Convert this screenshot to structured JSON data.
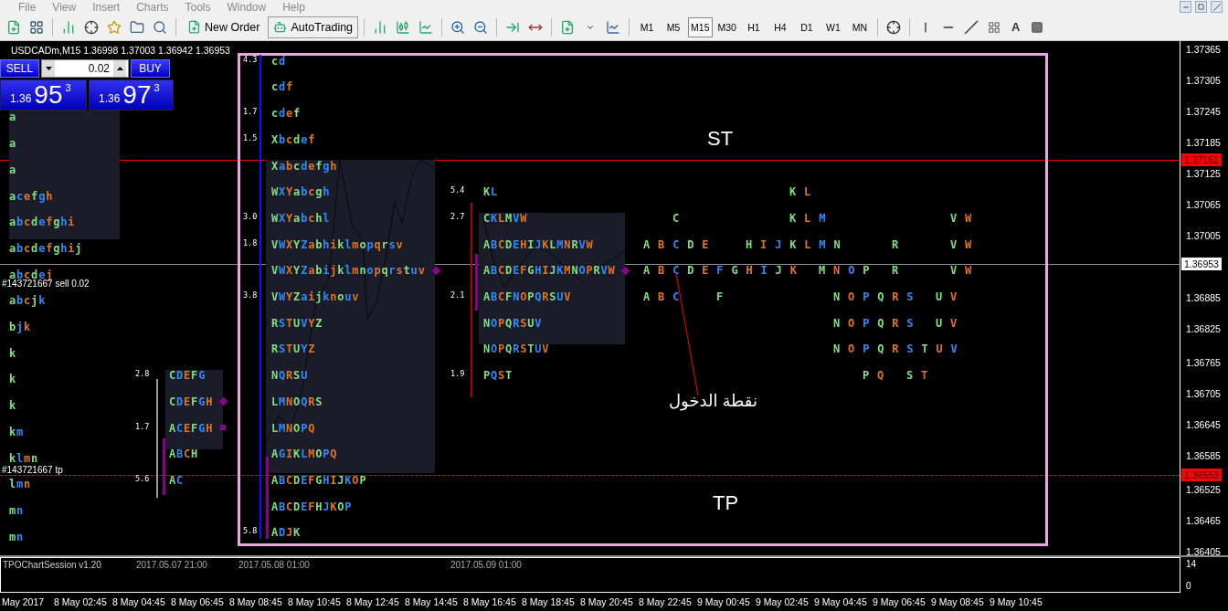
{
  "menu": [
    {
      "label": "File"
    },
    {
      "label": "View"
    },
    {
      "label": "Insert"
    },
    {
      "label": "Charts"
    },
    {
      "label": "Tools"
    },
    {
      "label": "Window"
    },
    {
      "label": "Help"
    }
  ],
  "toolbar": {
    "new_order": "New Order",
    "auto_trading": "AutoTrading",
    "text_tool": "A",
    "timeframes": [
      {
        "label": "M1",
        "selected": false
      },
      {
        "label": "M5",
        "selected": false
      },
      {
        "label": "M15",
        "selected": true
      },
      {
        "label": "M30",
        "selected": false
      },
      {
        "label": "H1",
        "selected": false
      },
      {
        "label": "H4",
        "selected": false
      },
      {
        "label": "D1",
        "selected": false
      },
      {
        "label": "W1",
        "selected": false
      },
      {
        "label": "MN",
        "selected": false
      }
    ]
  },
  "chart": {
    "symbol_info": "USDCADm,M15  1.36998 1.37003 1.36942 1.36953",
    "trade_panel": {
      "sell": "SELL",
      "buy": "BUY",
      "lot": "0.02",
      "sell_price": {
        "prefix": "1.36",
        "big": "95",
        "sup": "3"
      },
      "buy_price": {
        "prefix": "1.36",
        "big": "97",
        "sup": "3"
      }
    },
    "order_labels": [
      {
        "text": "#143721667 sell 0.02"
      },
      {
        "text": "#143721667 tp"
      }
    ],
    "profiles": [
      {
        "rows": [
          {
            "tpo": "a"
          },
          {
            "tpo": "a"
          },
          {
            "tpo": "a"
          },
          {
            "tpo": "acefgh"
          },
          {
            "tpo": "abcdefghi"
          },
          {
            "tpo": "abcdefghij"
          },
          {
            "tpo": "abcdej"
          },
          {
            "tpo": "abcjk"
          },
          {
            "tpo": "bjk"
          },
          {
            "tpo": "k"
          },
          {
            "tpo": "k"
          },
          {
            "tpo": "k"
          },
          {
            "tpo": "km"
          },
          {
            "tpo": "klmn"
          },
          {
            "tpo": "lmn"
          },
          {
            "tpo": "mn"
          },
          {
            "tpo": "mn"
          }
        ]
      },
      {
        "rows": [
          {
            "tpo": "cd",
            "stat": "4.3"
          },
          {
            "tpo": "cdf"
          },
          {
            "tpo": "cdef",
            "stat": "1.7"
          },
          {
            "tpo": "Xbcdef",
            "stat": "1.5"
          },
          {
            "tpo": "Xabcdefgh"
          },
          {
            "tpo": "WXYabcgh"
          },
          {
            "tpo": "WXYabchl",
            "stat": "3.0"
          },
          {
            "tpo": "VWXYZabhiklmopqrsv",
            "stat": "1.8"
          },
          {
            "tpo": "VWXYZabijklmnopqrstuv"
          },
          {
            "tpo": "VWYZaijknouv",
            "stat": "3.8"
          },
          {
            "tpo": "RSTUVYZ"
          },
          {
            "tpo": "RSTUYZ"
          },
          {
            "tpo": "NQRSU"
          },
          {
            "tpo": "LMNOQRS"
          },
          {
            "tpo": "LMNOPQ"
          },
          {
            "tpo": "AGIKLMOPQ"
          },
          {
            "tpo": "ABCDEFGHIJKOP"
          },
          {
            "tpo": "ABCDEFHJKOP"
          },
          {
            "tpo": "ADJK",
            "stat": "5.8"
          }
        ]
      },
      {
        "rows": [
          {
            "tpo": "KL",
            "stat": "5.4"
          },
          {
            "tpo": "CKLMVW",
            "stat": "2.7"
          },
          {
            "tpo": "ABCDEHIJKLMNRVW"
          },
          {
            "tpo": "ABCDEFGHIJKMNOPRVW"
          },
          {
            "tpo": "ABCFNOPQRSUV",
            "stat": "2.1"
          },
          {
            "tpo": "NOPQRSUV"
          },
          {
            "tpo": "NOPQRSTUV"
          },
          {
            "tpo": "PQST",
            "stat": "1.9"
          }
        ]
      },
      {
        "rows": [
          {
            "tpo": "CDEFG",
            "stat": "2.8"
          },
          {
            "tpo": "CDEFGH"
          },
          {
            "tpo": "ACEFGH",
            "stat": "1.7"
          },
          {
            "tpo": "ABCH"
          },
          {
            "tpo": "AC",
            "stat": "5.6"
          }
        ]
      }
    ],
    "letter_grid": [
      [
        "K L"
      ],
      [
        "C",
        "K L M",
        "V W"
      ],
      [
        "A B C D E",
        "H I J K L M N",
        "R",
        "V W"
      ],
      [
        "A B C D E F G H I J K",
        "M N O P",
        "R",
        "V W"
      ],
      [
        "A B C",
        "F",
        "N O P Q R S",
        "U V"
      ],
      [
        "N O P Q R S",
        "U V"
      ],
      [
        "N O P Q R S T U V"
      ],
      [
        "P Q",
        "S T"
      ]
    ],
    "annotations": {
      "stop": "ST",
      "take_profit": "TP",
      "entry": "نقطة الدخول"
    }
  },
  "price_axis": {
    "ticks": [
      "1.37365",
      "1.37305",
      "1.37245",
      "1.37185",
      "1.37125",
      "1.37065",
      "1.37005",
      "1.36885",
      "1.36825",
      "1.36765",
      "1.36705",
      "1.36645",
      "1.36585",
      "1.36525",
      "1.36465",
      "1.36405"
    ],
    "markers": [
      {
        "text": "1.37151",
        "kind": "stop"
      },
      {
        "text": "1.36953",
        "kind": "bid"
      },
      {
        "text": "1.36553",
        "kind": "tp"
      }
    ]
  },
  "indicator": {
    "title": "TPOChartSession v1.20",
    "sessions": [
      "2017.05.07 21:00",
      "2017.05.08 01:00",
      "2017.05.09 01:00"
    ],
    "scale": [
      "14",
      "0"
    ]
  },
  "time_axis": [
    "May 2017",
    "8 May 02:45",
    "8 May 04:45",
    "8 May 06:45",
    "8 May 08:45",
    "8 May 10:45",
    "8 May 12:45",
    "8 May 14:45",
    "8 May 16:45",
    "8 May 18:45",
    "8 May 20:45",
    "8 May 22:45",
    "9 May 00:45",
    "9 May 02:45",
    "9 May 04:45",
    "9 May 06:45",
    "9 May 08:45",
    "9 May 10:45"
  ]
}
